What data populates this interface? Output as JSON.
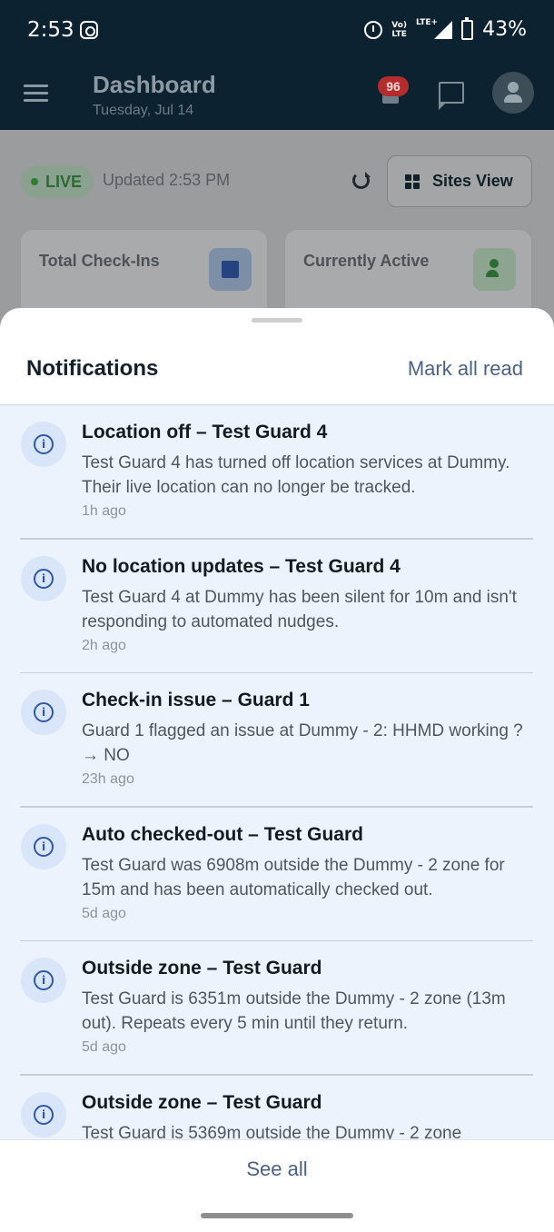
{
  "status_bar": {
    "time": "2:53",
    "volte": "Vo)\nLTE",
    "network": "LTE+",
    "battery": "43%"
  },
  "header": {
    "title": "Dashboard",
    "date": "Tuesday, Jul 14",
    "notification_badge": "96"
  },
  "dashboard": {
    "live_label": "LIVE",
    "updated": "Updated 2:53 PM",
    "sites_view_label": "Sites View",
    "cards": [
      {
        "title": "Total Check-Ins"
      },
      {
        "title": "Currently Active"
      }
    ]
  },
  "sheet": {
    "title": "Notifications",
    "mark_all_read": "Mark all read",
    "see_all": "See all",
    "notifications": [
      {
        "title": "Location off – Test Guard 4",
        "body": "Test Guard 4 has turned off location services at Dummy. Their live location can no longer be tracked.",
        "time": "1h ago"
      },
      {
        "title": "No location updates – Test Guard 4",
        "body": "Test Guard 4 at Dummy has been silent for 10m and isn't responding to automated nudges.",
        "time": "2h ago"
      },
      {
        "title": "Check-in issue – Guard 1",
        "body": "Guard 1 flagged an issue at Dummy - 2: HHMD working ? → NO",
        "time": "23h ago"
      },
      {
        "title": "Auto checked-out – Test Guard",
        "body": "Test Guard was 6908m outside the Dummy - 2 zone for 15m and has been automatically checked out.",
        "time": "5d ago"
      },
      {
        "title": "Outside zone – Test Guard",
        "body": "Test Guard is 6351m outside the Dummy - 2 zone (13m out). Repeats every 5 min until they return.",
        "time": "5d ago"
      },
      {
        "title": "Outside zone – Test Guard",
        "body": "Test Guard is 5369m outside the Dummy - 2 zone",
        "time": ""
      }
    ]
  }
}
